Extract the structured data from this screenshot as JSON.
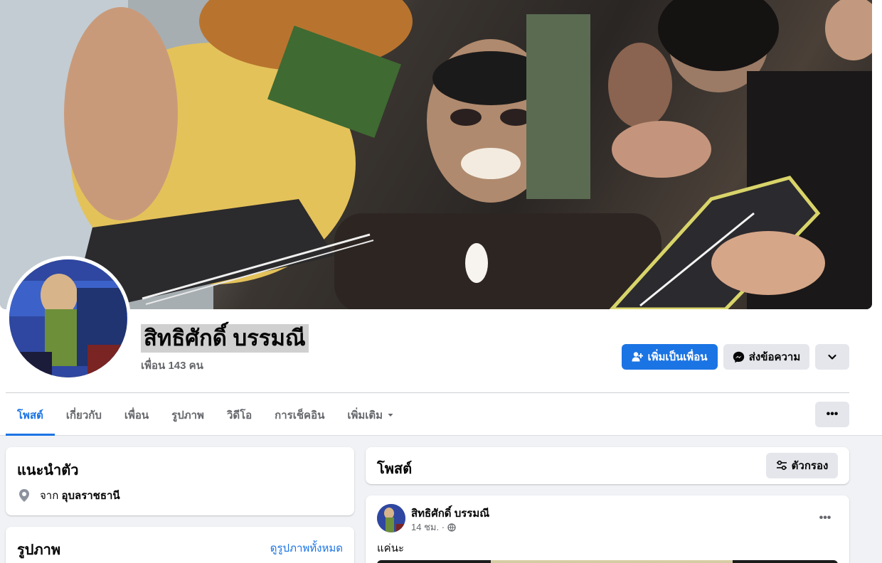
{
  "profile": {
    "name": "สิทธิศักดิ์ บรรมณี",
    "friends_text": "เพื่อน 143 คน"
  },
  "actions": {
    "add_friend": "เพิ่มเป็นเพื่อน",
    "message": "ส่งข้อความ",
    "dropdown_icon": "chevron-down-icon"
  },
  "tabs": [
    {
      "label": "โพสต์",
      "active": true
    },
    {
      "label": "เกี่ยวกับ",
      "active": false
    },
    {
      "label": "เพื่อน",
      "active": false
    },
    {
      "label": "รูปภาพ",
      "active": false
    },
    {
      "label": "วิดีโอ",
      "active": false
    },
    {
      "label": "การเช็คอิน",
      "active": false
    },
    {
      "label": "เพิ่มเติม",
      "active": false
    }
  ],
  "tab_more_icon": "•••",
  "intro": {
    "title": "แนะนำตัว",
    "from_label": "จาก",
    "from_value": "อุบลราชธานี"
  },
  "photos": {
    "title": "รูปภาพ",
    "see_all": "ดูรูปภาพทั้งหมด"
  },
  "posts_header": {
    "title": "โพสต์",
    "filter_label": "ตัวกรอง"
  },
  "post": {
    "author": "สิทธิศักดิ์ บรรมณี",
    "time": "14 ชม. ·",
    "text": "แค่นะ",
    "menu_icon": "•••"
  },
  "colors": {
    "accent": "#1b74e4",
    "background": "#f0f2f5",
    "secondary_button": "#e4e6eb"
  }
}
